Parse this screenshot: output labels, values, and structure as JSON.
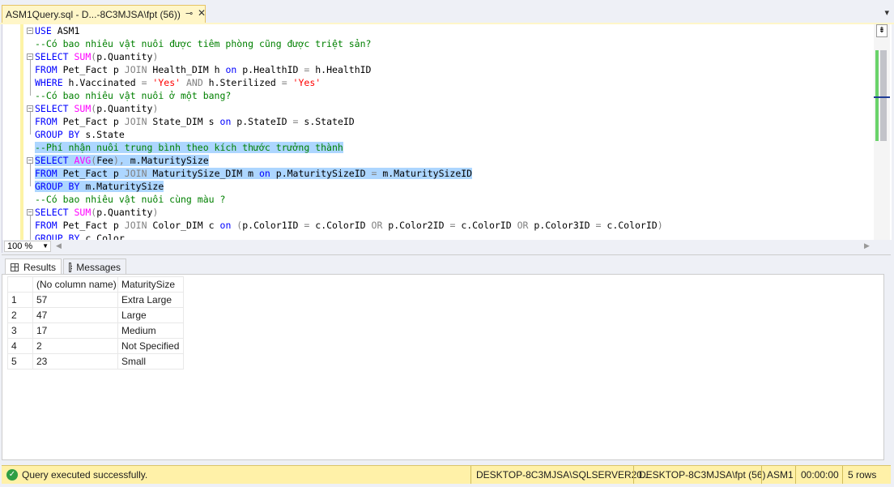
{
  "tab": {
    "title": "ASM1Query.sql - D...-8C3MJSA\\fpt (56))",
    "pin": "⊸",
    "close": "✕"
  },
  "editor": {
    "lines": [
      [
        {
          "t": "USE ",
          "c": "kw"
        },
        {
          "t": "ASM1",
          "c": "id"
        }
      ],
      [
        {
          "t": "--Có bao nhiêu vật nuôi được tiêm phòng cũng được triệt sản?",
          "c": "cm"
        }
      ],
      [
        {
          "t": "SELECT ",
          "c": "kw"
        },
        {
          "t": "SUM",
          "c": "fn"
        },
        {
          "t": "(",
          "c": "gr"
        },
        {
          "t": "p.Quantity",
          "c": "id"
        },
        {
          "t": ")",
          "c": "gr"
        }
      ],
      [
        {
          "t": "FROM ",
          "c": "kw"
        },
        {
          "t": "Pet_Fact p ",
          "c": "id"
        },
        {
          "t": "JOIN ",
          "c": "gr"
        },
        {
          "t": "Health_DIM h ",
          "c": "id"
        },
        {
          "t": "on ",
          "c": "kw"
        },
        {
          "t": "p.HealthID ",
          "c": "id"
        },
        {
          "t": "= ",
          "c": "gr"
        },
        {
          "t": "h.HealthID",
          "c": "id"
        }
      ],
      [
        {
          "t": "WHERE ",
          "c": "kw"
        },
        {
          "t": "h.Vaccinated ",
          "c": "id"
        },
        {
          "t": "= ",
          "c": "gr"
        },
        {
          "t": "'Yes' ",
          "c": "st"
        },
        {
          "t": "AND ",
          "c": "gr"
        },
        {
          "t": "h.Sterilized ",
          "c": "id"
        },
        {
          "t": "= ",
          "c": "gr"
        },
        {
          "t": "'Yes'",
          "c": "st"
        }
      ],
      [
        {
          "t": "--Có bao nhiêu vật nuôi ở một bang?",
          "c": "cm"
        }
      ],
      [
        {
          "t": "SELECT ",
          "c": "kw"
        },
        {
          "t": "SUM",
          "c": "fn"
        },
        {
          "t": "(",
          "c": "gr"
        },
        {
          "t": "p.Quantity",
          "c": "id"
        },
        {
          "t": ")",
          "c": "gr"
        }
      ],
      [
        {
          "t": "FROM ",
          "c": "kw"
        },
        {
          "t": "Pet_Fact p ",
          "c": "id"
        },
        {
          "t": "JOIN ",
          "c": "gr"
        },
        {
          "t": "State_DIM s ",
          "c": "id"
        },
        {
          "t": "on ",
          "c": "kw"
        },
        {
          "t": "p.StateID ",
          "c": "id"
        },
        {
          "t": "= ",
          "c": "gr"
        },
        {
          "t": "s.StateID",
          "c": "id"
        }
      ],
      [
        {
          "t": "GROUP BY ",
          "c": "kw"
        },
        {
          "t": "s.State",
          "c": "id"
        }
      ],
      [
        {
          "t": "--Phí nhận nuôi trung bình theo kích thước trưởng thành",
          "c": "cm"
        }
      ],
      [
        {
          "t": "SELECT ",
          "c": "kw"
        },
        {
          "t": "AVG",
          "c": "fn"
        },
        {
          "t": "(",
          "c": "gr"
        },
        {
          "t": "Fee",
          "c": "id"
        },
        {
          "t": "), ",
          "c": "gr"
        },
        {
          "t": "m.MaturitySize",
          "c": "id"
        }
      ],
      [
        {
          "t": "FROM ",
          "c": "kw"
        },
        {
          "t": "Pet_Fact p ",
          "c": "id"
        },
        {
          "t": "JOIN ",
          "c": "gr"
        },
        {
          "t": "MaturitySize_DIM m ",
          "c": "id"
        },
        {
          "t": "on ",
          "c": "kw"
        },
        {
          "t": "p.MaturitySizeID ",
          "c": "id"
        },
        {
          "t": "= ",
          "c": "gr"
        },
        {
          "t": "m.MaturitySizeID",
          "c": "id"
        }
      ],
      [
        {
          "t": "GROUP BY ",
          "c": "kw"
        },
        {
          "t": "m.MaturitySize",
          "c": "id"
        }
      ],
      [
        {
          "t": "--Có bao nhiêu vật nuôi cùng màu ?",
          "c": "cm"
        }
      ],
      [
        {
          "t": "SELECT ",
          "c": "kw"
        },
        {
          "t": "SUM",
          "c": "fn"
        },
        {
          "t": "(",
          "c": "gr"
        },
        {
          "t": "p.Quantity",
          "c": "id"
        },
        {
          "t": ")",
          "c": "gr"
        }
      ],
      [
        {
          "t": "FROM ",
          "c": "kw"
        },
        {
          "t": "Pet_Fact p ",
          "c": "id"
        },
        {
          "t": "JOIN ",
          "c": "gr"
        },
        {
          "t": "Color_DIM c ",
          "c": "id"
        },
        {
          "t": "on ",
          "c": "kw"
        },
        {
          "t": "(",
          "c": "gr"
        },
        {
          "t": "p.Color1ID ",
          "c": "id"
        },
        {
          "t": "= ",
          "c": "gr"
        },
        {
          "t": "c.ColorID ",
          "c": "id"
        },
        {
          "t": "OR ",
          "c": "gr"
        },
        {
          "t": "p.Color2ID ",
          "c": "id"
        },
        {
          "t": "= ",
          "c": "gr"
        },
        {
          "t": "c.ColorID ",
          "c": "id"
        },
        {
          "t": "OR ",
          "c": "gr"
        },
        {
          "t": "p.Color3ID ",
          "c": "id"
        },
        {
          "t": "= ",
          "c": "gr"
        },
        {
          "t": "c.ColorID",
          "c": "id"
        },
        {
          "t": ")",
          "c": "gr"
        }
      ],
      [
        {
          "t": "GROUP BY ",
          "c": "kw"
        },
        {
          "t": "c.Color",
          "c": "id"
        }
      ]
    ],
    "selected_lines": [
      9,
      10,
      11,
      12
    ],
    "zoom": "100 %"
  },
  "result_tabs": {
    "results": "Results",
    "messages": "Messages"
  },
  "results": {
    "columns": [
      "(No column name)",
      "MaturitySize"
    ],
    "rows": [
      {
        "n": "1",
        "v": "57",
        "s": "Extra Large"
      },
      {
        "n": "2",
        "v": "47",
        "s": "Large"
      },
      {
        "n": "3",
        "v": "17",
        "s": "Medium"
      },
      {
        "n": "4",
        "v": "2",
        "s": "Not Specified"
      },
      {
        "n": "5",
        "v": "23",
        "s": "Small"
      }
    ]
  },
  "status": {
    "message": "Query executed successfully.",
    "server": "DESKTOP-8C3MJSA\\SQLSERVER20...",
    "user": "DESKTOP-8C3MJSA\\fpt (56)",
    "database": "ASM1",
    "elapsed": "00:00:00",
    "rows": "5 rows"
  },
  "colors": {
    "keyword": "#0000ff",
    "comment": "#008000",
    "function": "#ff00ff",
    "string": "#ff0000",
    "operator": "#808080",
    "selection": "#add6ff",
    "status_bar": "#fff1a8"
  }
}
